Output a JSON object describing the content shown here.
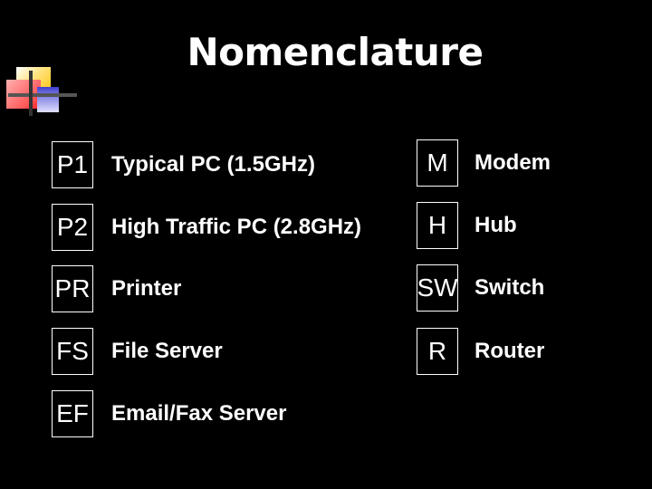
{
  "slide": {
    "title": "Nomenclature",
    "logo_icon": "colored-squares-logo"
  },
  "left_items": [
    {
      "code": "P1",
      "label": "Typical PC (1.5GHz)"
    },
    {
      "code": "P2",
      "label": "High Traffic PC (2.8GHz)"
    },
    {
      "code": "PR",
      "label": "Printer"
    },
    {
      "code": "FS",
      "label": "File Server"
    },
    {
      "code": "EF",
      "label": "Email/Fax Server"
    }
  ],
  "right_items": [
    {
      "code": "M",
      "label": "Modem"
    },
    {
      "code": "H",
      "label": "Hub"
    },
    {
      "code": "SW",
      "label": "Switch"
    },
    {
      "code": "R",
      "label": "Router"
    }
  ]
}
